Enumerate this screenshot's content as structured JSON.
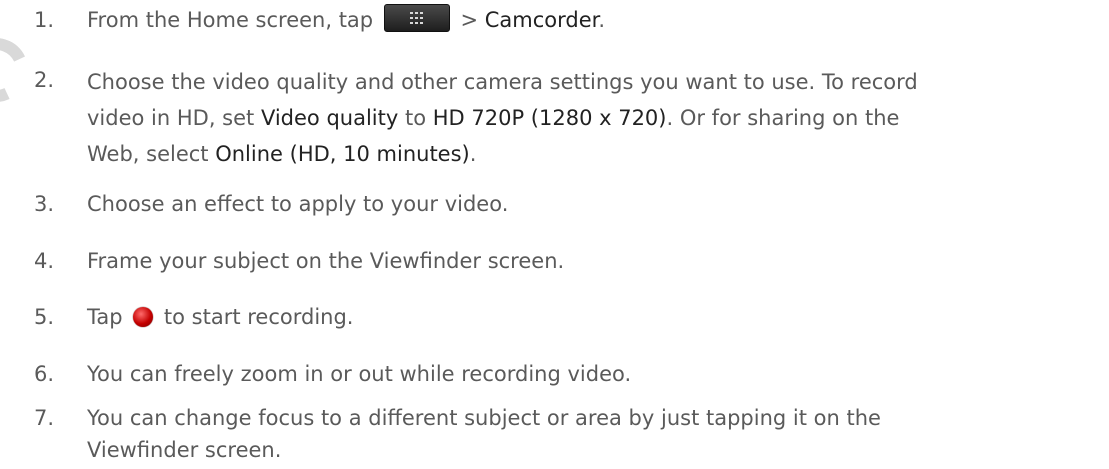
{
  "steps": [
    {
      "number": "1.",
      "text_before": "From the Home screen, tap ",
      "icon": "apps-grid-icon",
      "text_after": " > ",
      "emphasis": "Camcorder",
      "text_end": "."
    },
    {
      "number": "2.",
      "line1": "Choose the video quality and other camera settings you want to use. To record",
      "line2_before": "video in HD, set ",
      "line2_em1": "Video quality",
      "line2_mid": " to ",
      "line2_em2": "HD 720P (1280 x 720)",
      "line2_after": ". Or for sharing on the",
      "line3_before": "Web, select ",
      "line3_em": "Online (HD, 10 minutes)",
      "line3_after": "."
    },
    {
      "number": "3.",
      "text": "Choose an effect to apply to your video."
    },
    {
      "number": "4.",
      "text": "Frame your subject on the Viewfinder screen."
    },
    {
      "number": "5.",
      "text_before": "Tap ",
      "icon": "record-button-icon",
      "text_after": " to start recording."
    },
    {
      "number": "6.",
      "text": "You can freely zoom in or out while recording video."
    },
    {
      "number": "7.",
      "line1": "You can change focus to a different subject or area by just tapping it on the",
      "line2": "Viewfinder screen."
    }
  ],
  "colors": {
    "text": "#5a5a5a",
    "emphasis": "#222222",
    "record": "#c40000"
  }
}
